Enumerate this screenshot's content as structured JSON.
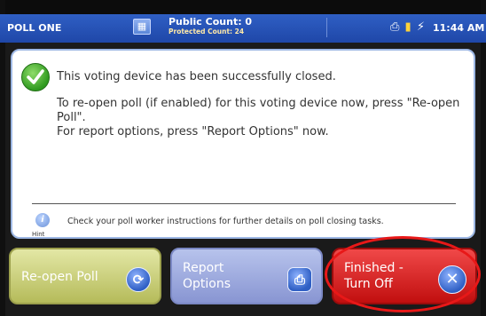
{
  "header": {
    "poll_name": "POLL ONE",
    "public_count": "Public Count: 0",
    "protected_count": "Protected Count: 24",
    "time": "11:44 AM",
    "status_icons": [
      "printer-icon",
      "memory-card-icon",
      "power-plug-icon"
    ]
  },
  "panel": {
    "line1": "This voting device has been successfully closed.",
    "line2a": "To re-open poll (if enabled) for this voting device now, press \"Re-open Poll\".",
    "line2b": "For report options, press \"Report Options\" now.",
    "hint_label": "Hint",
    "hint_text": "Check your poll worker instructions for further details on poll closing tasks."
  },
  "buttons": {
    "reopen": "Re-open Poll",
    "report_line1": "Report",
    "report_line2": "Options",
    "finish_line1": "Finished -",
    "finish_line2": "Turn Off"
  },
  "colors": {
    "header_blue": "#2a55bb",
    "reopen_yellow": "#cdd37a",
    "report_lavender": "#a0acdf",
    "finish_red": "#d92020",
    "highlight_oval": "#e81818"
  }
}
